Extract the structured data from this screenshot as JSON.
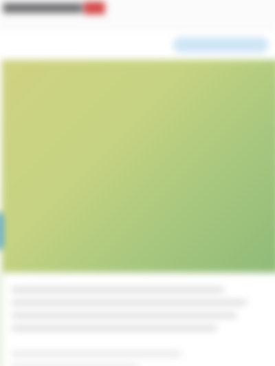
{
  "header": {
    "logo_icon": "site-logo"
  },
  "hero": {
    "colors": {
      "start": "#cfd281",
      "end": "#8dba78"
    }
  },
  "side_tab": {
    "color": "#5aa8cf"
  },
  "cta": {
    "color": "#cfe6f5"
  },
  "content": {
    "line_count": 6
  }
}
